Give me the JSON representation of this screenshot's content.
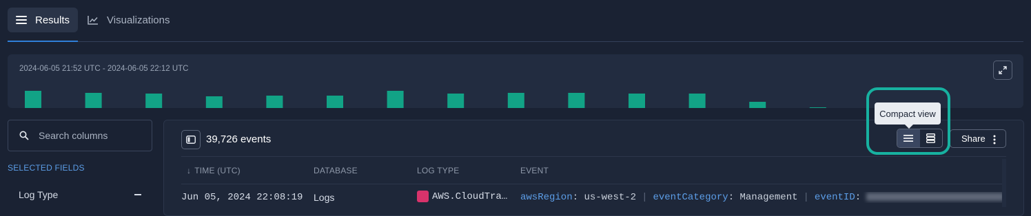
{
  "tabs": [
    {
      "label": "Results",
      "icon": "hamburger-icon",
      "active": true
    },
    {
      "label": "Visualizations",
      "icon": "line-chart-icon",
      "active": false
    }
  ],
  "histogram": {
    "range": "2024-06-05 21:52 UTC - 2024-06-05 22:12 UTC",
    "bar_color": "#12a386",
    "values": [
      25,
      22,
      21,
      17,
      18,
      18,
      25,
      21,
      22,
      22,
      21,
      21,
      9,
      1
    ]
  },
  "search": {
    "placeholder": "Search columns"
  },
  "selected_fields": {
    "title": "SELECTED FIELDS",
    "items": [
      "Log Type"
    ]
  },
  "results": {
    "count": "39,726 events",
    "share_label": "Share",
    "tooltip": "Compact view",
    "columns": [
      "TIME (UTC)",
      "DATABASE",
      "LOG TYPE",
      "EVENT"
    ],
    "sort_indicator": "↓",
    "rows": [
      {
        "time": "Jun 05, 2024 22:08:19",
        "database": "Logs",
        "log_type": "AWS.CloudTra…",
        "event": [
          {
            "key": "awsRegion",
            "value": "us-west-2"
          },
          {
            "key": "eventCategory",
            "value": "Management"
          },
          {
            "key": "eventID",
            "value": ""
          }
        ]
      }
    ]
  },
  "colors": {
    "accent": "#2f7fd8",
    "highlight": "#17b1a0",
    "tooltip_bg": "#e9ecf1"
  }
}
